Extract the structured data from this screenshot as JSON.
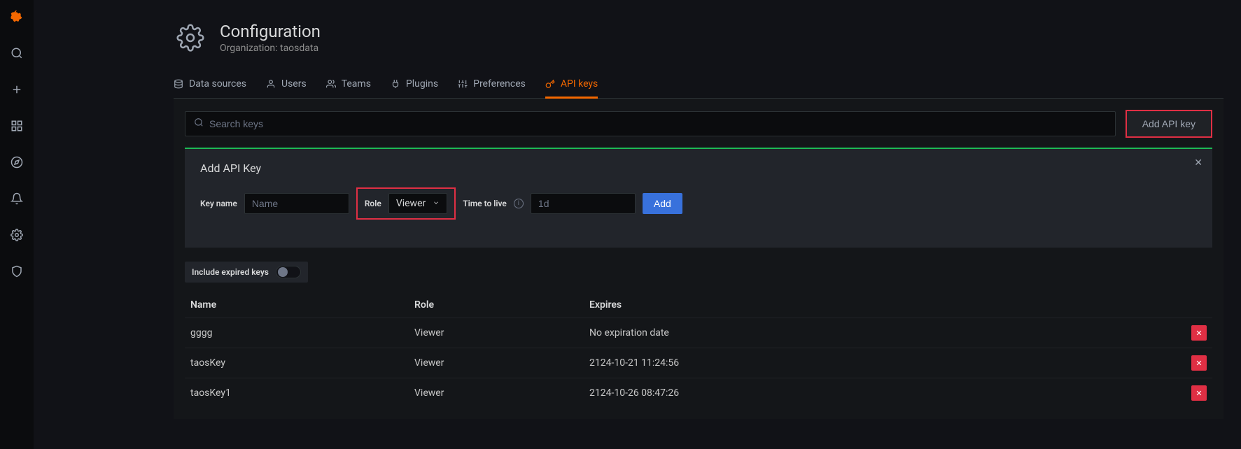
{
  "page": {
    "title": "Configuration",
    "subtitle": "Organization: taosdata"
  },
  "tabs": [
    {
      "label": "Data sources",
      "icon": "database-icon"
    },
    {
      "label": "Users",
      "icon": "user-icon"
    },
    {
      "label": "Teams",
      "icon": "users-icon"
    },
    {
      "label": "Plugins",
      "icon": "plug-icon"
    },
    {
      "label": "Preferences",
      "icon": "sliders-icon"
    },
    {
      "label": "API keys",
      "icon": "key-icon",
      "active": true
    }
  ],
  "search": {
    "placeholder": "Search keys"
  },
  "add_api_key_btn": "Add API key",
  "form": {
    "title": "Add API Key",
    "key_name_label": "Key name",
    "key_name_placeholder": "Name",
    "role_label": "Role",
    "role_value": "Viewer",
    "ttl_label": "Time to live",
    "ttl_placeholder": "1d",
    "add_btn": "Add"
  },
  "include_expired": {
    "label": "Include expired keys",
    "value": false
  },
  "table": {
    "headers": {
      "name": "Name",
      "role": "Role",
      "expires": "Expires"
    },
    "rows": [
      {
        "name": "gggg",
        "role": "Viewer",
        "expires": "No expiration date"
      },
      {
        "name": "taosKey",
        "role": "Viewer",
        "expires": "2124-10-21 11:24:56"
      },
      {
        "name": "taosKey1",
        "role": "Viewer",
        "expires": "2124-10-26 08:47:26"
      }
    ]
  }
}
